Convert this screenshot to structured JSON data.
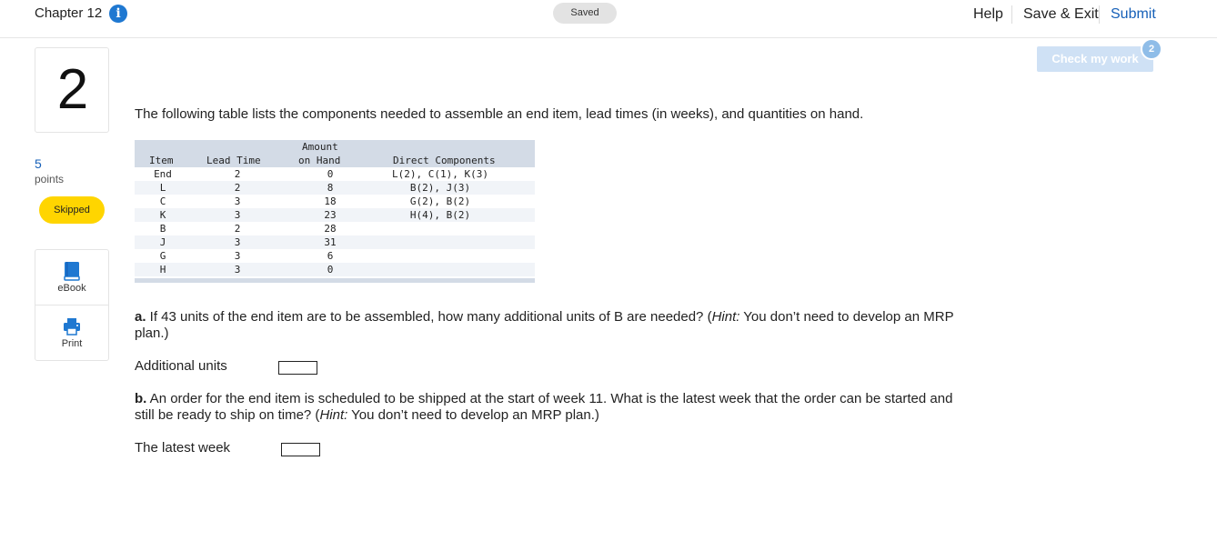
{
  "header": {
    "chapter": "Chapter 12",
    "info_glyph": "i",
    "saved": "Saved",
    "help": "Help",
    "save_exit": "Save & Exit",
    "submit": "Submit"
  },
  "question": {
    "number": "2",
    "points": "5",
    "points_label": "points",
    "status": "Skipped"
  },
  "tools": {
    "ebook": "eBook",
    "print": "Print",
    "ebook_icon": "book-icon",
    "print_icon": "printer-icon"
  },
  "check_work": {
    "label": "Check my work",
    "count": "2"
  },
  "intro": "The following table lists the components needed to assemble an end item, lead times (in weeks), and quantities on hand.",
  "table": {
    "headers": {
      "item": "Item",
      "lead": "Lead Time",
      "amount_1": "Amount",
      "amount_2": "on Hand",
      "components": "Direct Components"
    },
    "rows": [
      {
        "item": "End",
        "lead": "2",
        "amount": "0",
        "components": "L(2), C(1), K(3)"
      },
      {
        "item": "L",
        "lead": "2",
        "amount": "8",
        "components": "B(2), J(3)"
      },
      {
        "item": "C",
        "lead": "3",
        "amount": "18",
        "components": "G(2), B(2)"
      },
      {
        "item": "K",
        "lead": "3",
        "amount": "23",
        "components": "H(4), B(2)"
      },
      {
        "item": "B",
        "lead": "2",
        "amount": "28",
        "components": ""
      },
      {
        "item": "J",
        "lead": "3",
        "amount": "31",
        "components": ""
      },
      {
        "item": "G",
        "lead": "3",
        "amount": "6",
        "components": ""
      },
      {
        "item": "H",
        "lead": "3",
        "amount": "0",
        "components": ""
      }
    ]
  },
  "part_a": {
    "prefix": "a.",
    "text": " If 43 units of the end item are to be assembled, how many additional units of B are needed? (",
    "hint": "Hint:",
    "text2": " You don’t need to develop an MRP plan.)",
    "answer_label": "Additional units",
    "answer_value": ""
  },
  "part_b": {
    "prefix": "b.",
    "text": " An order for the end item is scheduled to be shipped at the start of week 11. What is the latest week that the order can be started and still be ready to ship on time? (",
    "hint": "Hint:",
    "text2": " You don’t need to develop an MRP plan.)",
    "answer_label": "The latest week",
    "answer_value": ""
  },
  "colors": {
    "accent": "#1660b8",
    "skipped": "#ffd500",
    "table_header": "#d3dbe6",
    "check_disabled": "#cfe1f5"
  }
}
